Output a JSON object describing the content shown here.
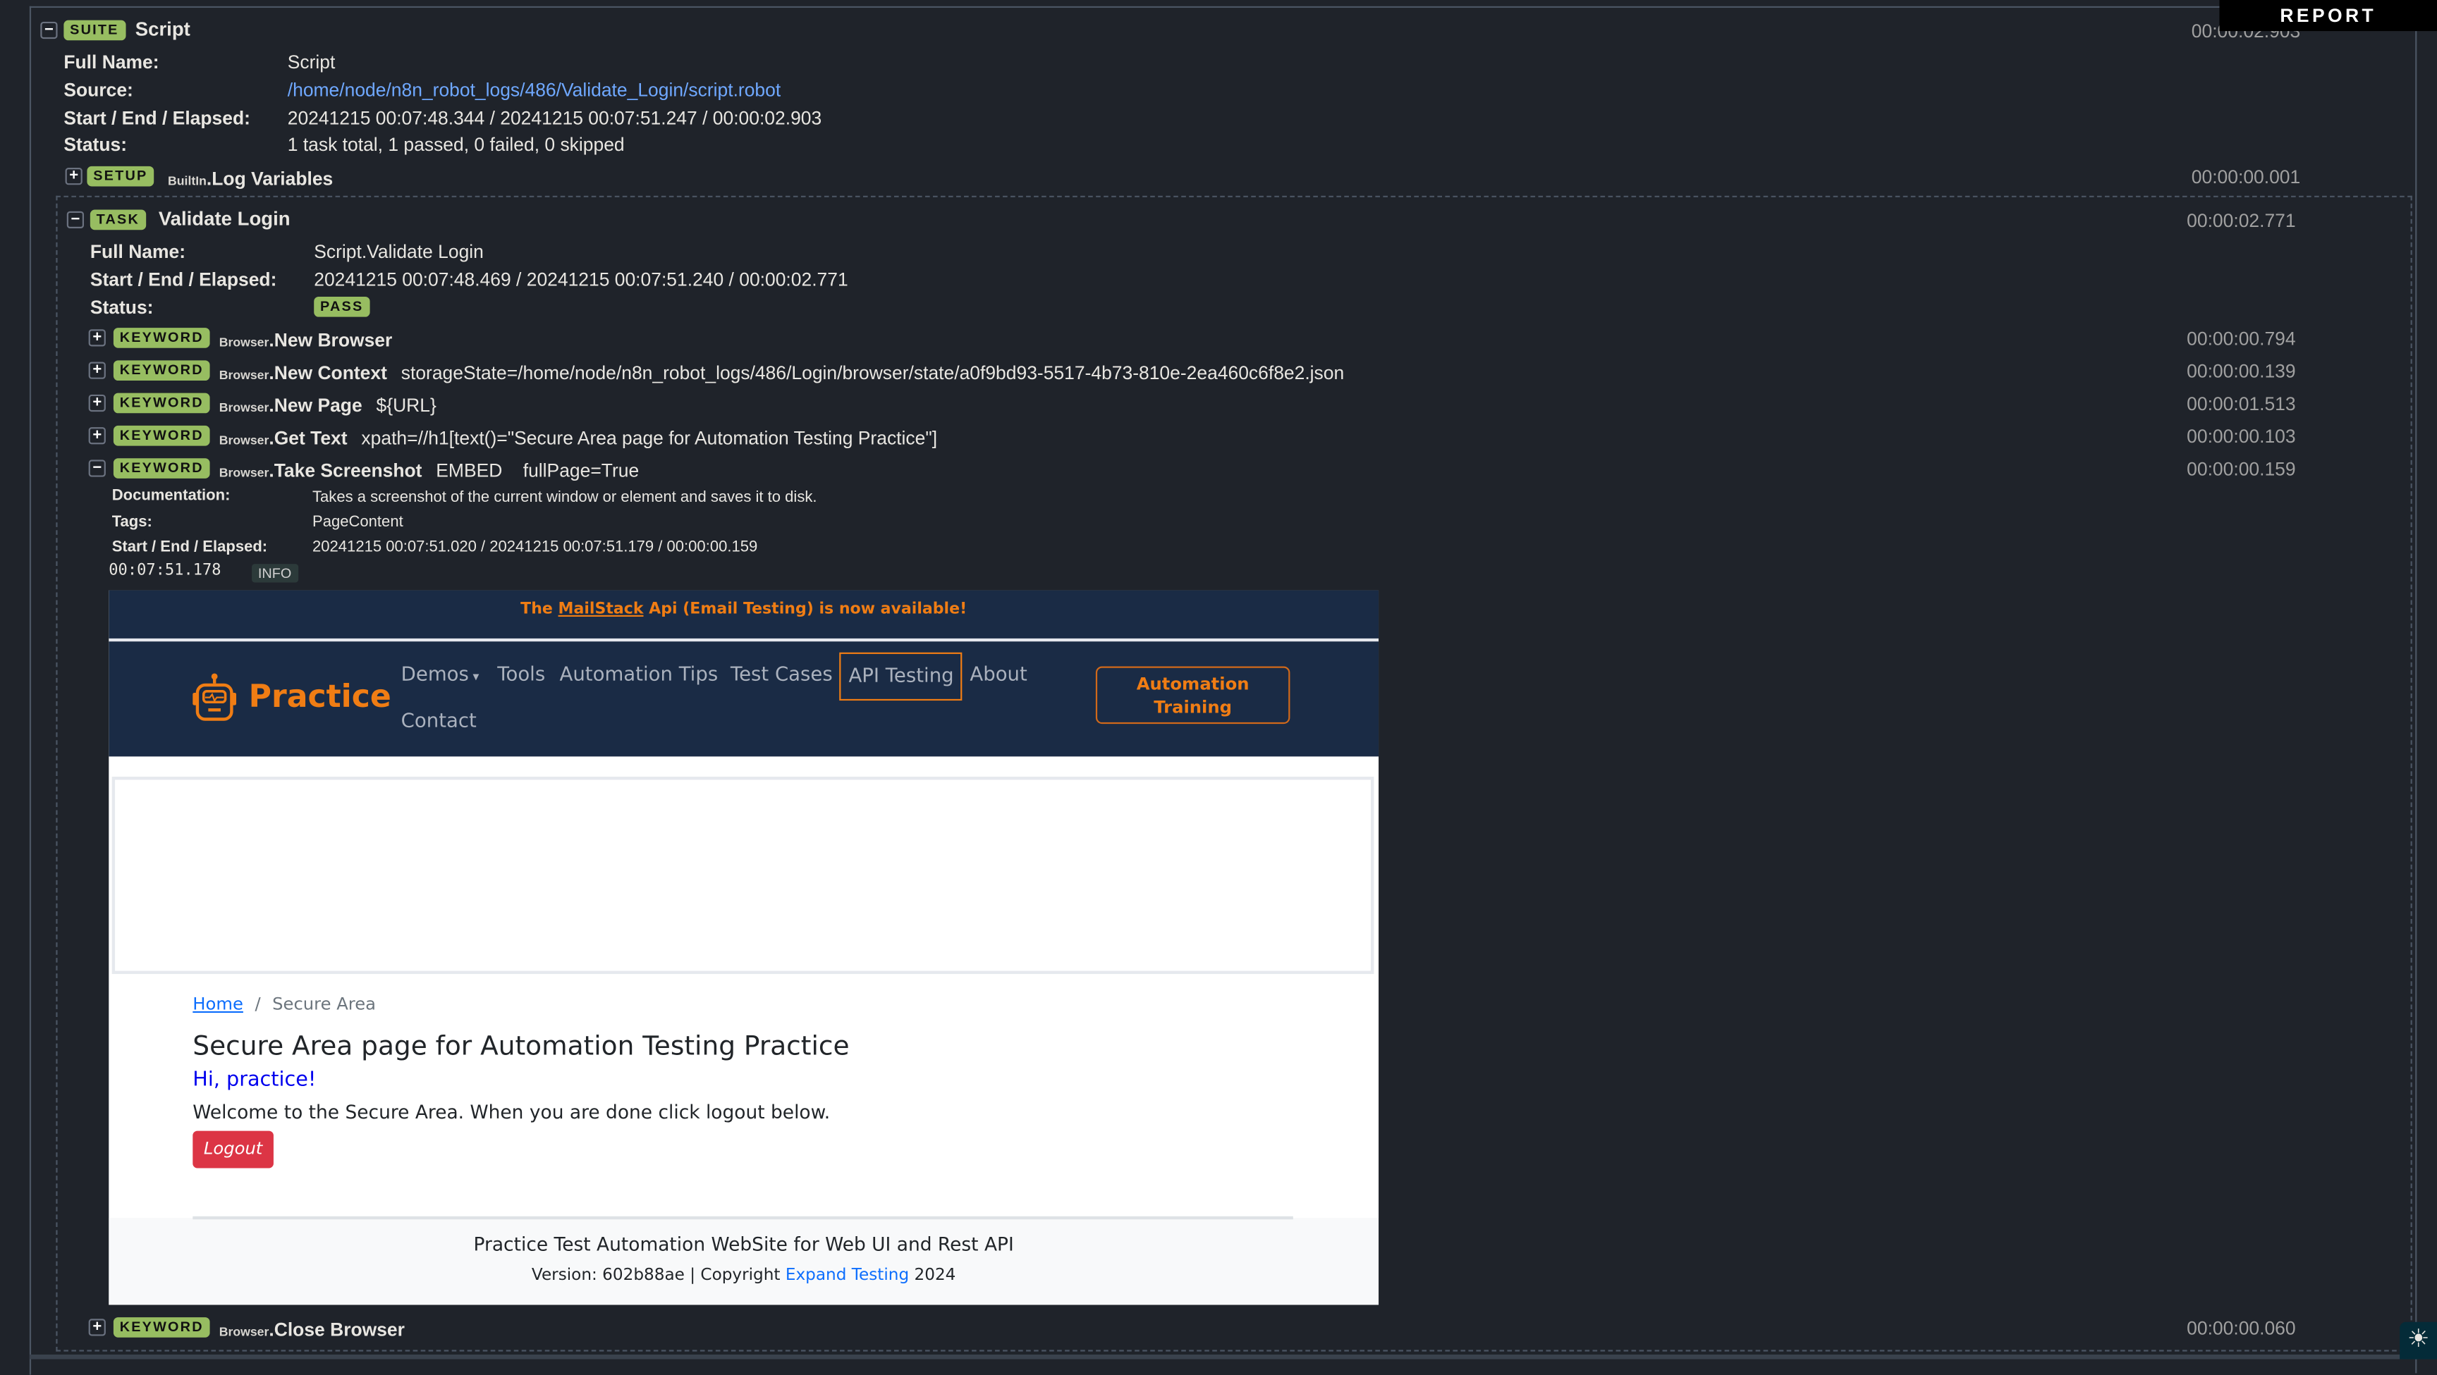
{
  "report_tab": "REPORT",
  "theme_toggle_icon": "sun-icon",
  "suite": {
    "badge": "SUITE",
    "name": "Script",
    "elapsed": "00:00:02.903",
    "fields": {
      "full_name_label": "Full Name:",
      "full_name": "Script",
      "source_label": "Source:",
      "source": "/home/node/n8n_robot_logs/486/Validate_Login/script.robot",
      "times_label": "Start / End / Elapsed:",
      "times": "20241215 00:07:48.344 / 20241215 00:07:51.247 / 00:00:02.903",
      "status_label": "Status:",
      "status": "1 task total, 1 passed, 0 failed, 0 skipped"
    },
    "setup": {
      "badge": "SETUP",
      "library": "BuiltIn",
      "name": "Log Variables",
      "elapsed": "00:00:00.001"
    }
  },
  "task": {
    "badge": "TASK",
    "name": "Validate Login",
    "elapsed": "00:00:02.771",
    "fields": {
      "full_name_label": "Full Name:",
      "full_name": "Script.Validate Login",
      "times_label": "Start / End / Elapsed:",
      "times": "20241215 00:07:48.469 / 20241215 00:07:51.240 / 00:00:02.771",
      "status_label": "Status:",
      "status": "PASS"
    },
    "keywords": [
      {
        "badge": "KEYWORD",
        "library": "Browser",
        "name": "New Browser",
        "args": "",
        "elapsed": "00:00:00.794",
        "expanded": false
      },
      {
        "badge": "KEYWORD",
        "library": "Browser",
        "name": "New Context",
        "args": "storageState=/home/node/n8n_robot_logs/486/Login/browser/state/a0f9bd93-5517-4b73-810e-2ea460c6f8e2.json",
        "elapsed": "00:00:00.139",
        "expanded": false
      },
      {
        "badge": "KEYWORD",
        "library": "Browser",
        "name": "New Page",
        "args": "${URL}",
        "elapsed": "00:00:01.513",
        "expanded": false
      },
      {
        "badge": "KEYWORD",
        "library": "Browser",
        "name": "Get Text",
        "args": "xpath=//h1[text()=\"Secure Area page for Automation Testing Practice\"]",
        "elapsed": "00:00:00.103",
        "expanded": false
      },
      {
        "badge": "KEYWORD",
        "library": "Browser",
        "name": "Take Screenshot",
        "args": "EMBED    fullPage=True",
        "elapsed": "00:00:00.159",
        "expanded": true
      },
      {
        "badge": "KEYWORD",
        "library": "Browser",
        "name": "Close Browser",
        "args": "",
        "elapsed": "00:00:00.060",
        "expanded": false
      }
    ],
    "screenshot_kw": {
      "doc_label": "Documentation:",
      "doc": "Takes a screenshot of the current window or element and saves it to disk.",
      "tags_label": "Tags:",
      "tags": "PageContent",
      "times_label": "Start / End / Elapsed:",
      "times": "20241215 00:07:51.020 / 20241215 00:07:51.179 / 00:00:00.159",
      "msg_time": "00:07:51.178",
      "msg_level": "INFO"
    }
  },
  "embedded_page": {
    "banner_pre": "The ",
    "banner_link": "MailStack",
    "banner_post": " Api (Email Testing) is now available!",
    "logo_text": "Practice",
    "nav": [
      "Demos",
      "Tools",
      "Automation Tips",
      "Test Cases",
      "API Testing",
      "About",
      "Contact"
    ],
    "cta": "Automation Training",
    "breadcrumb_home": "Home",
    "breadcrumb_sep": "/",
    "breadcrumb_current": "Secure Area",
    "heading": "Secure Area page for Automation Testing Practice",
    "greeting": "Hi, practice!",
    "welcome": "Welcome to the Secure Area. When you are done click logout below.",
    "logout": "Logout",
    "footer_title": "Practice Test Automation WebSite for Web UI and Rest API",
    "footer_version": "Version: 602b88ae | Copyright ",
    "footer_link": "Expand Testing",
    "footer_year": " 2024"
  },
  "colors": {
    "badge": "#97bd61",
    "accent_orange": "#f07d14",
    "navy": "#1a2b45",
    "logout_red": "#dc3545"
  }
}
